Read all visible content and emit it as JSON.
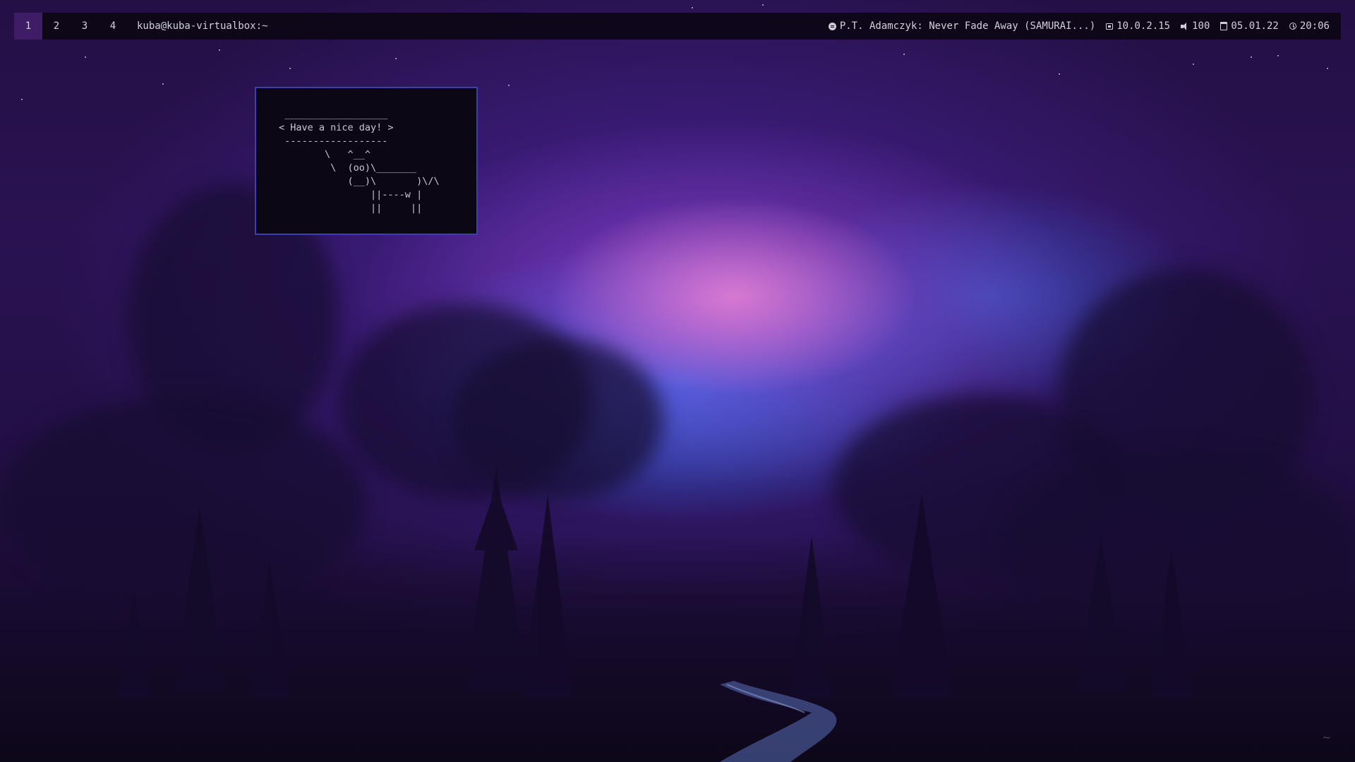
{
  "topbar": {
    "workspaces": [
      {
        "label": "1",
        "active": true
      },
      {
        "label": "2",
        "active": false
      },
      {
        "label": "3",
        "active": false
      },
      {
        "label": "4",
        "active": false
      }
    ],
    "window_title": "kuba@kuba-virtualbox:~",
    "now_playing": {
      "icon": "music-icon",
      "text": "P.T. Adamczyk: Never Fade Away (SAMURAI...)"
    },
    "network": {
      "icon": "network-icon",
      "text": "10.0.2.15"
    },
    "volume": {
      "icon": "volume-icon",
      "text": "100"
    },
    "date": {
      "icon": "calendar-icon",
      "text": "05.01.22"
    },
    "time": {
      "icon": "clock-icon",
      "text": "20:06"
    }
  },
  "terminal": {
    "content": " __________________\n< Have a nice day! >\n ------------------\n        \\   ^__^\n         \\  (oo)\\_______\n            (__)\\       )\\/\\\n                ||----w |\n                ||     ||"
  },
  "colors": {
    "accent_active_workspace": "#3f1d66",
    "terminal_border": "#3d3fb0",
    "bar_background": "#0a0612"
  }
}
